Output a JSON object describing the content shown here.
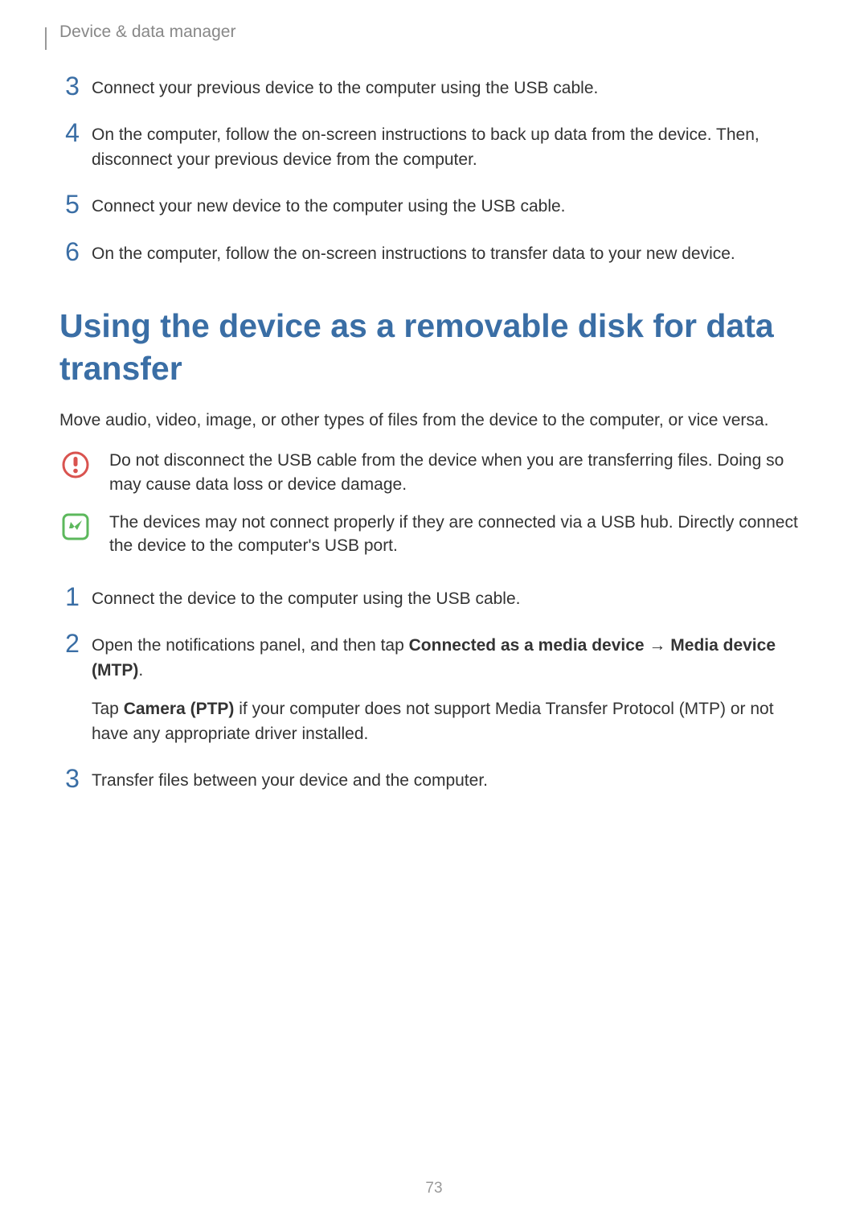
{
  "breadcrumb": "Device & data manager",
  "steps_a": [
    {
      "num": "3",
      "text": "Connect your previous device to the computer using the USB cable."
    },
    {
      "num": "4",
      "text": "On the computer, follow the on-screen instructions to back up data from the device. Then, disconnect your previous device from the computer."
    },
    {
      "num": "5",
      "text": "Connect your new device to the computer using the USB cable."
    },
    {
      "num": "6",
      "text": "On the computer, follow the on-screen instructions to transfer data to your new device."
    }
  ],
  "section_title": "Using the device as a removable disk for data transfer",
  "intro": "Move audio, video, image, or other types of files from the device to the computer, or vice versa.",
  "note_warning": "Do not disconnect the USB cable from the device when you are transferring files. Doing so may cause data loss or device damage.",
  "note_info": "The devices may not connect properly if they are connected via a USB hub. Directly connect the device to the computer's USB port.",
  "steps_b": {
    "s1_num": "1",
    "s1_text": "Connect the device to the computer using the USB cable.",
    "s2_num": "2",
    "s2_pre": "Open the notifications panel, and then tap ",
    "s2_bold1": "Connected as a media device",
    "s2_arrow": " → ",
    "s2_bold2": "Media device (MTP)",
    "s2_period": ".",
    "s2_para_pre": "Tap ",
    "s2_para_bold": "Camera (PTP)",
    "s2_para_post": " if your computer does not support Media Transfer Protocol (MTP) or not have any appropriate driver installed.",
    "s3_num": "3",
    "s3_text": "Transfer files between your device and the computer."
  },
  "page_number": "73"
}
